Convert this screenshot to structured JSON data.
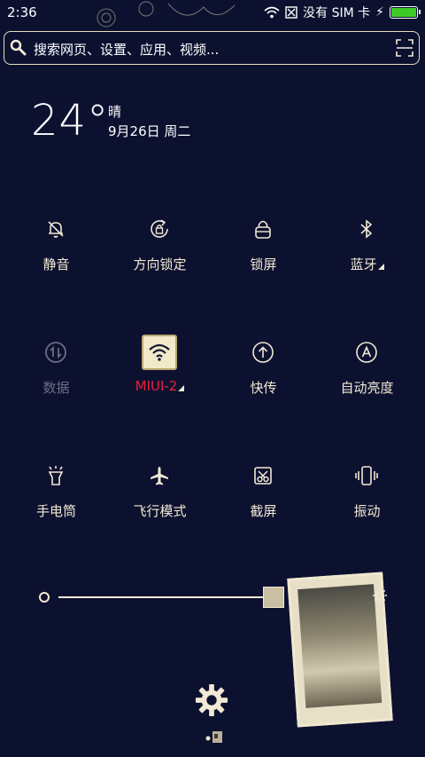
{
  "status": {
    "time": "2:36",
    "carrier": "没有 SIM 卡",
    "battery_level": 1.0
  },
  "search": {
    "placeholder": "搜索网页、设置、应用、视频..."
  },
  "weather": {
    "temperature": "24°",
    "condition": "晴",
    "date": "9月26日 周二"
  },
  "tiles": [
    {
      "label": "静音",
      "icon": "mute-bell-icon",
      "state": "off"
    },
    {
      "label": "方向锁定",
      "icon": "rotation-lock-icon",
      "state": "off"
    },
    {
      "label": "锁屏",
      "icon": "lock-icon",
      "state": "off"
    },
    {
      "label": "蓝牙",
      "icon": "bluetooth-icon",
      "state": "off"
    },
    {
      "label": "数据",
      "icon": "data-arrows-icon",
      "state": "disabled"
    },
    {
      "label": "MIUI-2",
      "icon": "wifi-icon",
      "state": "on"
    },
    {
      "label": "快传",
      "icon": "quick-transfer-icon",
      "state": "off"
    },
    {
      "label": "自动亮度",
      "icon": "auto-brightness-icon",
      "state": "off"
    },
    {
      "label": "手电筒",
      "icon": "flashlight-icon",
      "state": "off"
    },
    {
      "label": "飞行模式",
      "icon": "airplane-icon",
      "state": "off"
    },
    {
      "label": "截屏",
      "icon": "screenshot-icon",
      "state": "off"
    },
    {
      "label": "振动",
      "icon": "vibrate-icon",
      "state": "off"
    }
  ],
  "brightness": {
    "level": 0.95
  },
  "colors": {
    "background": "#0d1130",
    "accent": "#e8213a",
    "foreground": "#f1e9d4",
    "battery": "#3ecb2a"
  }
}
